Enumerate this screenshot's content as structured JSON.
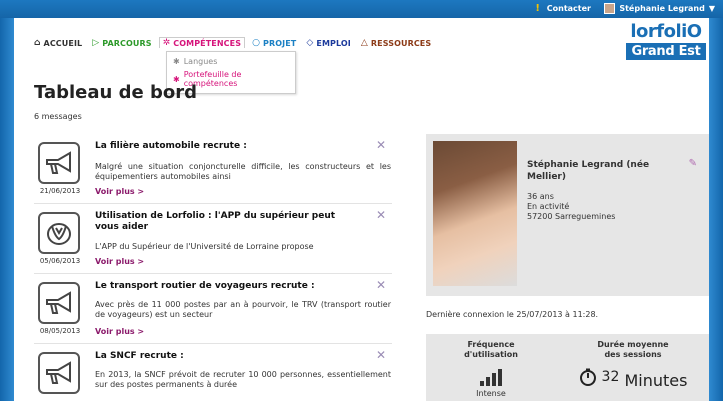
{
  "topbar": {
    "contact_label": "Contacter",
    "user_label": "Stéphanie Legrand"
  },
  "nav": {
    "items": [
      {
        "label": "ACCUEIL",
        "icon": "home-icon",
        "color": "#333333"
      },
      {
        "label": "PARCOURS",
        "icon": "tag-icon",
        "color": "#2d9a2a"
      },
      {
        "label": "COMPÉTENCES",
        "icon": "gear-icon",
        "color": "#d6147b"
      },
      {
        "label": "PROJET",
        "icon": "circle-icon",
        "color": "#1b80c4"
      },
      {
        "label": "EMPLOI",
        "icon": "diamond-icon",
        "color": "#1c3a9c"
      },
      {
        "label": "RESSOURCES",
        "icon": "triangle-icon",
        "color": "#8c3a17"
      }
    ],
    "submenu": [
      {
        "label": "Langues"
      },
      {
        "label": "Portefeuille de compétences"
      }
    ]
  },
  "logo": {
    "line1": "lorfoliO",
    "line2": "Grand Est"
  },
  "page": {
    "title": "Tableau de bord",
    "message_count": "6 messages"
  },
  "messages": [
    {
      "title": "La filière automobile recrute :",
      "excerpt": "Malgré une situation conjoncturelle difficile, les constructeurs et les équipementiers automobiles ainsi",
      "date": "21/06/2013",
      "more": "Voir plus >",
      "icon": "megaphone-icon"
    },
    {
      "title": "Utilisation de Lorfolio : l'APP du supérieur peut vous aider",
      "excerpt": " L'APP du Supérieur de l'Université de Lorraine propose",
      "date": "05/06/2013",
      "more": "Voir plus >",
      "icon": "handshake-icon"
    },
    {
      "title": "Le transport routier de voyageurs recrute :",
      "excerpt": "Avec près de 11 000 postes par an à pourvoir, le TRV (transport routier de voyageurs) est un secteur",
      "date": "08/05/2013",
      "more": "Voir plus >",
      "icon": "megaphone-icon"
    },
    {
      "title": "La SNCF recrute :",
      "excerpt": "En 2013, la SNCF prévoit de recruter 10 000 personnes, essentiellement sur des postes permanents à durée",
      "date": "",
      "more": "",
      "icon": "megaphone-icon"
    }
  ],
  "profile": {
    "name": "Stéphanie Legrand (née Mellier)",
    "age": "36 ans",
    "status": "En activité",
    "location": "57200 Sarreguemines"
  },
  "last_connection": "Dernière connexion le 25/07/2013 à 11:28.",
  "stats": {
    "frequency_title_1": "Fréquence",
    "frequency_title_2": "d'utilisation",
    "frequency_label": "Intense",
    "frequency_level": 4,
    "duration_title_1": "Durée moyenne",
    "duration_title_2": "des sessions",
    "duration_value": "32",
    "duration_unit": "Minutes"
  }
}
